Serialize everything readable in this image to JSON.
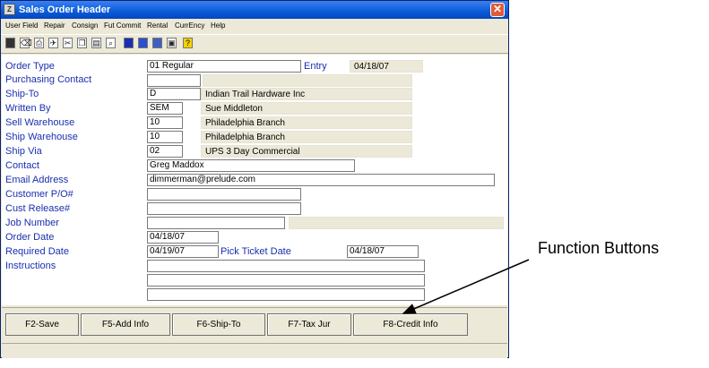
{
  "window": {
    "title": "Sales Order Header",
    "app_icon": "app-icon",
    "close_glyph": "✕"
  },
  "menu": [
    "User Field",
    "Repair",
    "Consign",
    "Fut Commit",
    "Rental",
    "CurrEncy",
    "Help"
  ],
  "toolbar_icons": [
    "save-icon",
    "delete-icon",
    "print-icon",
    "run-icon",
    "cut-icon",
    "copy-icon",
    "paste-icon",
    "find-icon",
    "book-icon",
    "binoculars-icon",
    "calculator-icon",
    "image-icon",
    "help-icon"
  ],
  "labels": {
    "order_type": "Order Type",
    "purchasing_contact": "Purchasing Contact",
    "ship_to": "Ship-To",
    "written_by": "Written By",
    "sell_warehouse": "Sell Warehouse",
    "ship_warehouse": "Ship Warehouse",
    "ship_via": "Ship Via",
    "contact": "Contact",
    "email_address": "Email Address",
    "customer_po": "Customer P/O#",
    "cust_release": "Cust Release#",
    "job_number": "Job Number",
    "order_date": "Order Date",
    "required_date": "Required Date",
    "instructions": "Instructions",
    "entry": "Entry",
    "pick_ticket_date": "Pick Ticket Date"
  },
  "values": {
    "order_type": "01 Regular",
    "entry_date": "04/18/07",
    "purchasing_contact": "",
    "ship_to_code": "D",
    "ship_to_name": "Indian Trail Hardware Inc",
    "written_by_code": "SEM",
    "written_by_name": "Sue Middleton",
    "sell_warehouse_code": "10",
    "sell_warehouse_name": "Philadelphia Branch",
    "ship_warehouse_code": "10",
    "ship_warehouse_name": "Philadelphia Branch",
    "ship_via_code": "02",
    "ship_via_name": "UPS 3 Day Commercial",
    "contact": "Greg Maddox",
    "email": "dimmerman@prelude.com",
    "customer_po": "",
    "cust_release": "",
    "job_number": "",
    "order_date": "04/18/07",
    "required_date": "04/19/07",
    "pick_ticket_date": "04/18/07",
    "instructions_1": "",
    "instructions_2": "",
    "instructions_3": ""
  },
  "function_buttons": {
    "save": "F2-Save",
    "add_info": "F5-Add Info",
    "ship_to": "F6-Ship-To",
    "tax_jur": "F7-Tax Jur",
    "credit_info": "F8-Credit Info"
  },
  "annotation": "Function Buttons"
}
